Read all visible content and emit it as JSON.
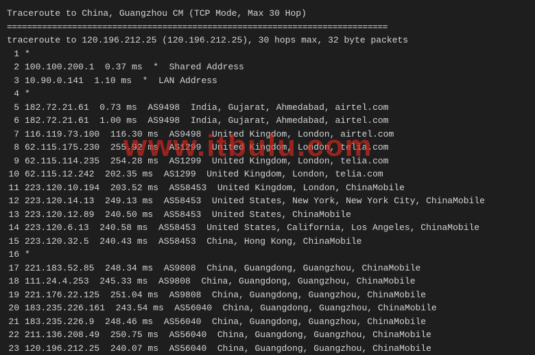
{
  "header": "Traceroute to China, Guangzhou CM (TCP Mode, Max 30 Hop)",
  "separator": "============================================================================",
  "info": "traceroute to 120.196.212.25 (120.196.212.25), 30 hops max, 32 byte packets",
  "watermark": "www.itbulu.com",
  "hops": [
    {
      "num": "1",
      "text": "*"
    },
    {
      "num": "2",
      "text": "100.100.200.1  0.37 ms  *  Shared Address"
    },
    {
      "num": "3",
      "text": "10.90.0.141  1.10 ms  *  LAN Address"
    },
    {
      "num": "4",
      "text": "*"
    },
    {
      "num": "5",
      "text": "182.72.21.61  0.73 ms  AS9498  India, Gujarat, Ahmedabad, airtel.com"
    },
    {
      "num": "6",
      "text": "182.72.21.61  1.00 ms  AS9498  India, Gujarat, Ahmedabad, airtel.com"
    },
    {
      "num": "7",
      "text": "116.119.73.100  116.30 ms  AS9498  United Kingdom, London, airtel.com"
    },
    {
      "num": "8",
      "text": "62.115.175.230  255.92 ms  AS1299  United Kingdom, London, telia.com"
    },
    {
      "num": "9",
      "text": "62.115.114.235  254.28 ms  AS1299  United Kingdom, London, telia.com"
    },
    {
      "num": "10",
      "text": "62.115.12.242  202.35 ms  AS1299  United Kingdom, London, telia.com"
    },
    {
      "num": "11",
      "text": "223.120.10.194  203.52 ms  AS58453  United Kingdom, London, ChinaMobile"
    },
    {
      "num": "12",
      "text": "223.120.14.13  249.13 ms  AS58453  United States, New York, New York City, ChinaMobile"
    },
    {
      "num": "13",
      "text": "223.120.12.89  240.50 ms  AS58453  United States, ChinaMobile"
    },
    {
      "num": "14",
      "text": "223.120.6.13  240.58 ms  AS58453  United States, California, Los Angeles, ChinaMobile"
    },
    {
      "num": "15",
      "text": "223.120.32.5  240.43 ms  AS58453  China, Hong Kong, ChinaMobile"
    },
    {
      "num": "16",
      "text": "*"
    },
    {
      "num": "17",
      "text": "221.183.52.85  248.34 ms  AS9808  China, Guangdong, Guangzhou, ChinaMobile"
    },
    {
      "num": "18",
      "text": "111.24.4.253  245.33 ms  AS9808  China, Guangdong, Guangzhou, ChinaMobile"
    },
    {
      "num": "19",
      "text": "221.176.22.125  251.04 ms  AS9808  China, Guangdong, Guangzhou, ChinaMobile"
    },
    {
      "num": "20",
      "text": "183.235.226.161  243.54 ms  AS56040  China, Guangdong, Guangzhou, ChinaMobile"
    },
    {
      "num": "21",
      "text": "183.235.226.9  248.46 ms  AS56040  China, Guangdong, Guangzhou, ChinaMobile"
    },
    {
      "num": "22",
      "text": "211.136.208.49  250.75 ms  AS56040  China, Guangdong, Guangzhou, ChinaMobile"
    },
    {
      "num": "23",
      "text": "120.196.212.25  240.07 ms  AS56040  China, Guangdong, Guangzhou, ChinaMobile"
    }
  ]
}
